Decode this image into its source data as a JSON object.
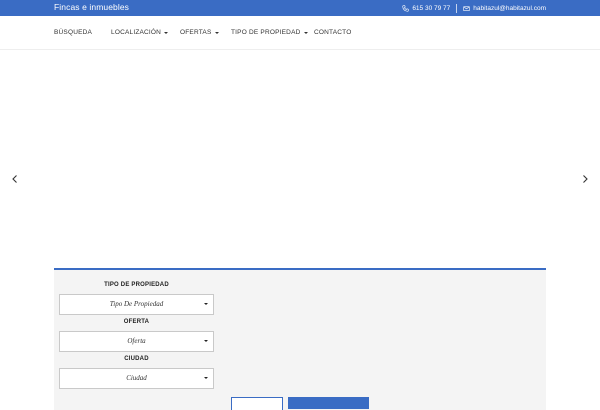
{
  "header": {
    "brand": "Fincas e inmuebles",
    "phone": "615 30 79 77",
    "email": "habitazul@habitazul.com"
  },
  "nav": {
    "items": [
      {
        "label": "BÚSQUEDA"
      },
      {
        "label": "LOCALIZACIÓN"
      },
      {
        "label": "OFERTAS"
      },
      {
        "label": "TIPO DE PROPIEDAD"
      },
      {
        "label": "CONTACTO"
      }
    ]
  },
  "search": {
    "type_label": "TIPO DE PROPIEDAD",
    "type_value": "Tipo De Propiedad",
    "offer_label": "OFERTA",
    "offer_value": "Oferta",
    "city_label": "CIUDAD",
    "city_value": "Ciudad"
  },
  "colors": {
    "accent": "#3a6cc4"
  },
  "icons": {
    "phone": "phone-icon",
    "email": "mail-icon",
    "prev": "chevron-left-icon",
    "next": "chevron-right-icon"
  }
}
